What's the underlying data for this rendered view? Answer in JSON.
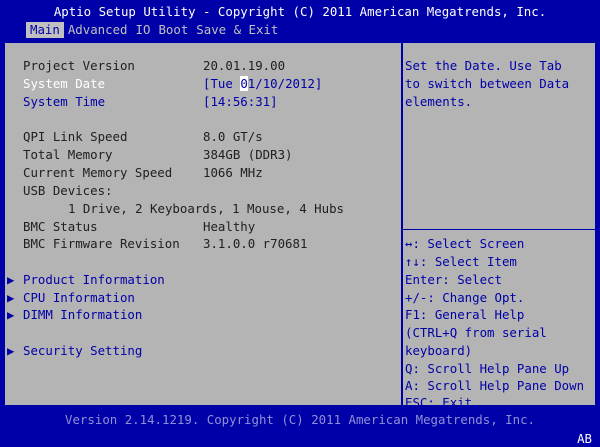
{
  "title": "Aptio Setup Utility - Copyright (C) 2011 American Megatrends, Inc.",
  "menu": [
    "Main",
    "Advanced",
    "IO",
    "Boot",
    "Save & Exit"
  ],
  "info": [
    {
      "label": "Project Version",
      "value": "20.01.19.00"
    },
    {
      "label": "System Date",
      "value_before": "[Tue ",
      "value_hl": "0",
      "value_after": "1/10/2012]"
    },
    {
      "label": "System Time",
      "value": "[14:56:31]"
    },
    {
      "label": "QPI Link Speed",
      "value": "8.0 GT/s"
    },
    {
      "label": "Total Memory",
      "value": "384GB (DDR3)"
    },
    {
      "label": "Current Memory Speed",
      "value": "1066 MHz"
    },
    {
      "label": "USB Devices:"
    },
    {
      "label": "1 Drive, 2 Keyboards, 1 Mouse, 4 Hubs"
    },
    {
      "label": "BMC Status",
      "value": "Healthy"
    },
    {
      "label": "BMC Firmware Revision",
      "value": "3.1.0.0 r70681"
    }
  ],
  "submenus": [
    {
      "arrow": "▶",
      "label": "Product Information"
    },
    {
      "arrow": "▶",
      "label": "CPU Information"
    },
    {
      "arrow": "▶",
      "label": "DIMM Information"
    },
    {
      "arrow": "▶",
      "label": "Security Setting"
    }
  ],
  "help_text": [
    "Set the Date. Use Tab",
    "to switch between Data",
    "elements."
  ],
  "keys": [
    "↔: Select Screen",
    "↑↓: Select Item",
    "Enter: Select",
    "+/-: Change Opt.",
    "F1: General Help",
    "(CTRL+Q from serial",
    "keyboard)",
    "Q: Scroll Help Pane Up",
    "A: Scroll Help Pane Down",
    "ESC: Exit"
  ],
  "footer": "Version 2.14.1219. Copyright (C) 2011 American Megatrends, Inc.",
  "corner": "AB"
}
